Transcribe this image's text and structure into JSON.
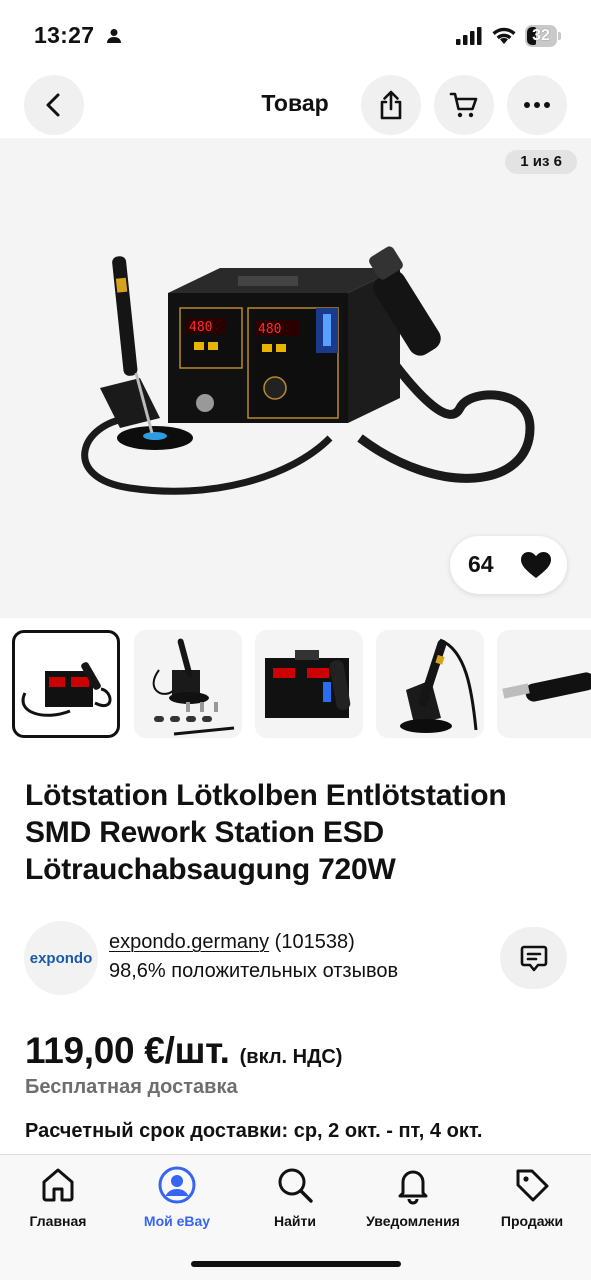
{
  "status_bar": {
    "time": "13:27",
    "battery": "32"
  },
  "nav": {
    "title": "Товар",
    "icons": [
      "back-arrow-icon",
      "share-icon",
      "cart-icon",
      "more-dots-icon"
    ]
  },
  "gallery": {
    "counter": "1 из 6",
    "likes": "64",
    "thumbnail_count": 5
  },
  "product": {
    "title": "Lötstation Lötkolben Entlötstation SMD Rework Station ESD Lötrauchabsaugung 720W"
  },
  "seller": {
    "logo_text": "expondo",
    "name": "expondo.germany",
    "rating_count": "(101538)",
    "feedback": "98,6% положительных отзывов"
  },
  "pricing": {
    "price": "119,00 €/шт.",
    "vat_note": "(вкл. НДС)",
    "shipping": "Бесплатная доставка",
    "delivery_estimate": "Расчетный срок доставки: ср, 2 окт. - пт, 4 окт."
  },
  "tabs": [
    {
      "label": "Главная",
      "icon": "home-icon",
      "active": false
    },
    {
      "label": "Мой eBay",
      "icon": "profile-icon",
      "active": true
    },
    {
      "label": "Найти",
      "icon": "search-icon",
      "active": false
    },
    {
      "label": "Уведомления",
      "icon": "bell-icon",
      "active": false
    },
    {
      "label": "Продажи",
      "icon": "tag-icon",
      "active": false
    }
  ],
  "colors": {
    "accent": "#3665f3",
    "text": "#111111",
    "muted": "#6e6e6e",
    "surface": "#f4f4f4"
  }
}
